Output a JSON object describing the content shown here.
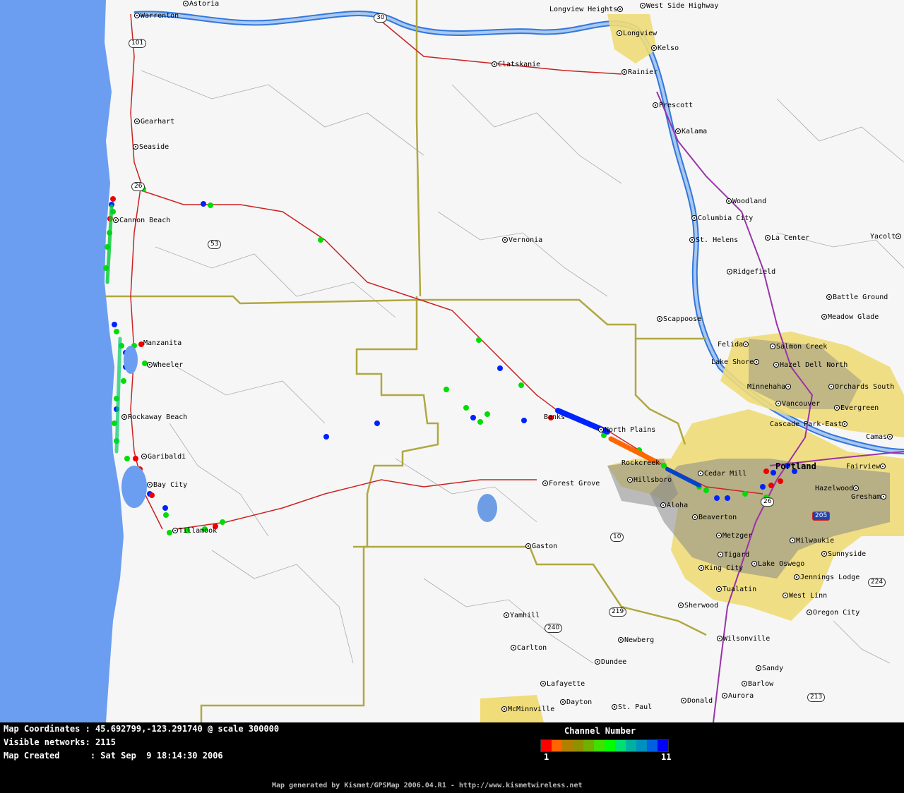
{
  "map": {
    "cities": [
      {
        "name": "Astoria"
      },
      {
        "name": "Warrenton"
      },
      {
        "name": "Longview Heights"
      },
      {
        "name": "West Side Highway"
      },
      {
        "name": "Longview"
      },
      {
        "name": "Kelso"
      },
      {
        "name": "Clatskanie"
      },
      {
        "name": "Rainier"
      },
      {
        "name": "Gearhart"
      },
      {
        "name": "Seaside"
      },
      {
        "name": "Prescott"
      },
      {
        "name": "Kalama"
      },
      {
        "name": "Cannon Beach"
      },
      {
        "name": "Woodland"
      },
      {
        "name": "Columbia City"
      },
      {
        "name": "Vernonia"
      },
      {
        "name": "St. Helens"
      },
      {
        "name": "La Center"
      },
      {
        "name": "Yacolt"
      },
      {
        "name": "Ridgefield"
      },
      {
        "name": "Battle Ground"
      },
      {
        "name": "Scappoose"
      },
      {
        "name": "Meadow Glade"
      },
      {
        "name": "Felida"
      },
      {
        "name": "Salmon Creek"
      },
      {
        "name": "Manzanita"
      },
      {
        "name": "Wheeler"
      },
      {
        "name": "Lake Shore"
      },
      {
        "name": "Hazel Dell North"
      },
      {
        "name": "Minnehaha"
      },
      {
        "name": "Orchards South"
      },
      {
        "name": "Rockaway Beach"
      },
      {
        "name": "Vancouver"
      },
      {
        "name": "Evergreen"
      },
      {
        "name": "Cascade Park-East"
      },
      {
        "name": "North Plains"
      },
      {
        "name": "Camas"
      },
      {
        "name": "Garibaldi"
      },
      {
        "name": "Rockcreek"
      },
      {
        "name": "Cedar Mill"
      },
      {
        "name": "Portland"
      },
      {
        "name": "Fairview"
      },
      {
        "name": "Bay City"
      },
      {
        "name": "Forest Grove"
      },
      {
        "name": "Hillsboro"
      },
      {
        "name": "Hazelwood"
      },
      {
        "name": "Aloha"
      },
      {
        "name": "Gresham"
      },
      {
        "name": "Tillamook"
      },
      {
        "name": "Beaverton"
      },
      {
        "name": "Metzger"
      },
      {
        "name": "Gaston"
      },
      {
        "name": "Milwaukie"
      },
      {
        "name": "Tigard"
      },
      {
        "name": "Sunnyside"
      },
      {
        "name": "Lake Oswego"
      },
      {
        "name": "King City"
      },
      {
        "name": "Jennings Lodge"
      },
      {
        "name": "Tualatin"
      },
      {
        "name": "West Linn"
      },
      {
        "name": "Sherwood"
      },
      {
        "name": "Oregon City"
      },
      {
        "name": "Yamhill"
      },
      {
        "name": "Newberg"
      },
      {
        "name": "Wilsonville"
      },
      {
        "name": "Carlton"
      },
      {
        "name": "Dundee"
      },
      {
        "name": "Sandy"
      },
      {
        "name": "Lafayette"
      },
      {
        "name": "Barlow"
      },
      {
        "name": "Aurora"
      },
      {
        "name": "Dayton"
      },
      {
        "name": "McMinnville"
      },
      {
        "name": "St. Paul"
      },
      {
        "name": "Donald"
      },
      {
        "name": "Banks"
      }
    ],
    "shields": [
      "30",
      "101",
      "26",
      "53",
      "10",
      "219",
      "240",
      "213",
      "224",
      "205",
      "26"
    ]
  },
  "info": {
    "coordinates_label": "Map Coordinates : 45.692799,-123.291740 @ scale 300000",
    "networks_label": "Visible networks: 2115",
    "created_label": "Map Created      : Sat Sep  9 18:14:30 2006"
  },
  "legend": {
    "title": "Channel Number",
    "min": "1",
    "max": "11",
    "colors": [
      "#ff0000",
      "#ff6600",
      "#b08000",
      "#909000",
      "#70b000",
      "#40e000",
      "#00ff00",
      "#00e070",
      "#00b0a0",
      "#0090c0",
      "#0060e0",
      "#0000ff"
    ]
  },
  "credit": "Map generated by Kismet/GPSMap 2006.04.R1 - http://www.kismetwireless.net",
  "colors": {
    "ocean": "#6b9ef0",
    "urban": "#f0dc78",
    "county_line": "#b0a840",
    "highway": "#cc2222",
    "interstate": "#9933aa",
    "river": "#3377dd"
  }
}
